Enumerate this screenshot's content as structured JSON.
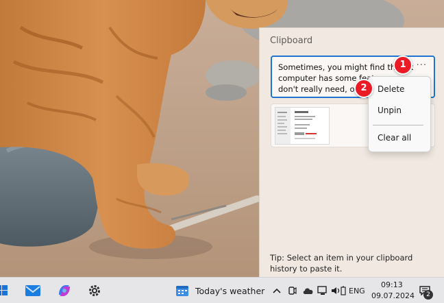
{
  "clipboard": {
    "title": "Clipboard",
    "items": [
      {
        "lines": [
          "Sometimes, you might find that yo",
          "computer has some features you",
          "don't really need, or m"
        ],
        "more_label": "···"
      },
      {
        "kind": "image"
      }
    ],
    "tip": "Tip: Select an item in your clipboard history to paste it."
  },
  "context_menu": {
    "items": [
      "Delete",
      "Unpin",
      "Clear all"
    ]
  },
  "callouts": [
    "1",
    "2"
  ],
  "taskbar": {
    "pinned_icons": [
      "start-icon",
      "mail-icon",
      "copilot-icon",
      "settings-icon"
    ],
    "weather": {
      "icon": "weather-icon",
      "label": "Today's weather"
    },
    "tray_icons": [
      "chevron-up-icon",
      "camera-icon",
      "cloud-icon",
      "network-icon",
      "speaker-icon",
      "battery-icon"
    ],
    "language": "ENG",
    "time": "09:13",
    "date": "09.07.2024",
    "notification_count": "2"
  },
  "colors": {
    "accent": "#1d74d1",
    "callout": "#ea1b25",
    "panel_bg": "#f1e9e1"
  }
}
